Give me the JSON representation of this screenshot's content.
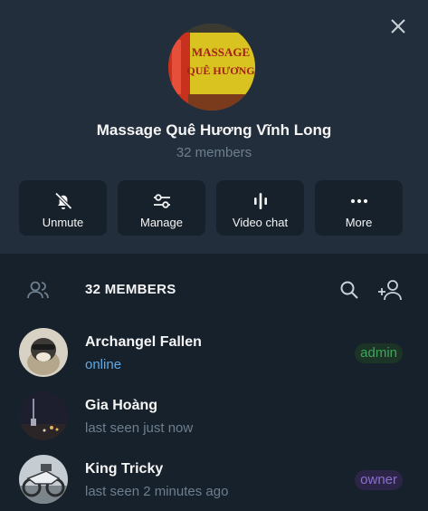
{
  "group": {
    "title": "Massage Quê Hương Vĩnh Long",
    "subtitle": "32 members",
    "avatar_sign_line1": "MASSAGE",
    "avatar_sign_line2": "QUÊ HƯƠNG"
  },
  "actions": [
    {
      "label": "Unmute",
      "icon": "bell-off-icon"
    },
    {
      "label": "Manage",
      "icon": "sliders-icon"
    },
    {
      "label": "Video chat",
      "icon": "audio-bars-icon"
    },
    {
      "label": "More",
      "icon": "dots-icon"
    }
  ],
  "members_header": {
    "title": "32 MEMBERS"
  },
  "members": [
    {
      "name": "Archangel Fallen",
      "status": "online",
      "badge": "admin"
    },
    {
      "name": "Gia Hoàng",
      "status": "last seen just now",
      "badge": ""
    },
    {
      "name": "King Tricky",
      "status": "last seen 2 minutes ago",
      "badge": "owner"
    }
  ],
  "colors": {
    "background": "#17212b",
    "header_background": "#232e3c",
    "accent_online": "#5eaae8",
    "admin_badge": "#3fa45c",
    "owner_badge": "#8b6fcf"
  }
}
